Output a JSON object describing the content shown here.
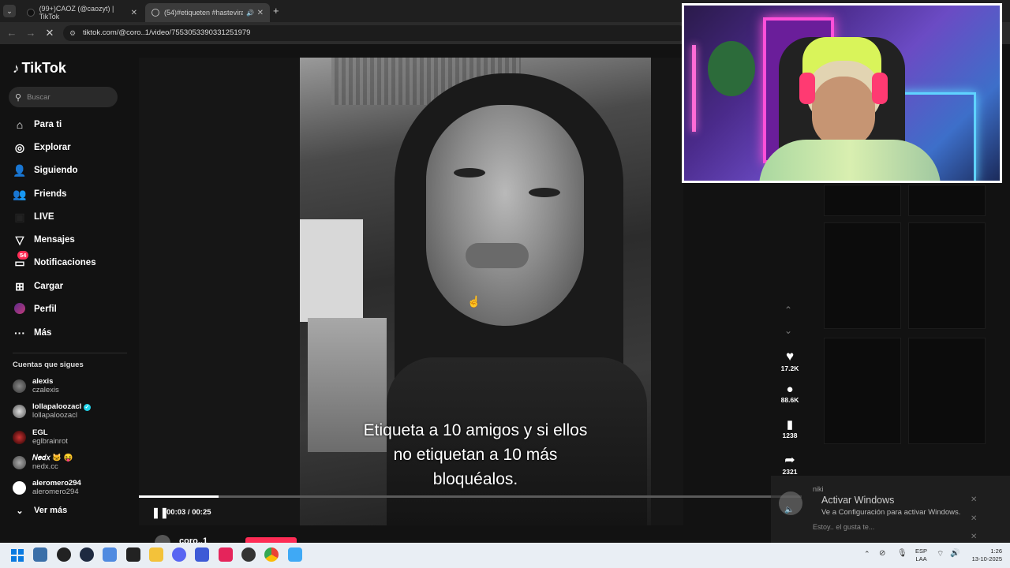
{
  "tabs": [
    {
      "label": "(99+)CAOZ (@caozyt) | TikTok"
    },
    {
      "label": "(54)#etiqueten #hasteviral"
    }
  ],
  "url": "tiktok.com/@coro..1/video/7553053390331251979",
  "tiktok": {
    "logo": "TikTok",
    "search_placeholder": "Buscar",
    "nav": [
      {
        "label": "Para ti",
        "icon": "home-icon"
      },
      {
        "label": "Explorar",
        "icon": "compass-icon"
      },
      {
        "label": "Siguiendo",
        "icon": "following-icon"
      },
      {
        "label": "Friends",
        "icon": "friends-icon"
      },
      {
        "label": "LIVE",
        "icon": "live-icon"
      },
      {
        "label": "Mensajes",
        "icon": "send-icon"
      },
      {
        "label": "Notificaciones",
        "icon": "inbox-icon",
        "badge": "54"
      },
      {
        "label": "Cargar",
        "icon": "upload-icon"
      },
      {
        "label": "Perfil",
        "icon": "avatar-icon"
      },
      {
        "label": "Más",
        "icon": "more-icon"
      }
    ],
    "following_title": "Cuentas que sigues",
    "following": [
      {
        "name": "alexis",
        "handle": "czalexis"
      },
      {
        "name": "lollapaloozacl",
        "handle": "lollapaloozacl",
        "verified": true
      },
      {
        "name": "EGL",
        "handle": "eglbrainrot"
      },
      {
        "name": "𝑁𝑒𝑑𝑥 🐱 😝",
        "handle": "nedx.cc"
      },
      {
        "name": "aleromero294",
        "handle": "aleromero294"
      }
    ],
    "see_more": "Ver más"
  },
  "video": {
    "caption_lines": [
      "Etiqueta a 10 amigos y si ellos",
      "no etiquetan a 10 más",
      "bloquéalos."
    ],
    "time": "00:03 / 00:25",
    "progress": 0.12,
    "author": "coro..1"
  },
  "actions": {
    "likes": "17.2K",
    "comments": "88.6K",
    "saves": "1238",
    "shares": "2321"
  },
  "notification": {
    "user": "niki",
    "text": "Estoy.. el gusta te..."
  },
  "windows_watermark": {
    "title": "Activar Windows",
    "subtitle": "Ve a Configuración para activar Windows."
  },
  "taskbar": {
    "lang": "ESP",
    "lang2": "LAA",
    "time": "1:26",
    "date": "13-10-2025"
  },
  "colors": {
    "tiktok_red": "#fe2c55",
    "badge": "#fe2c55"
  }
}
